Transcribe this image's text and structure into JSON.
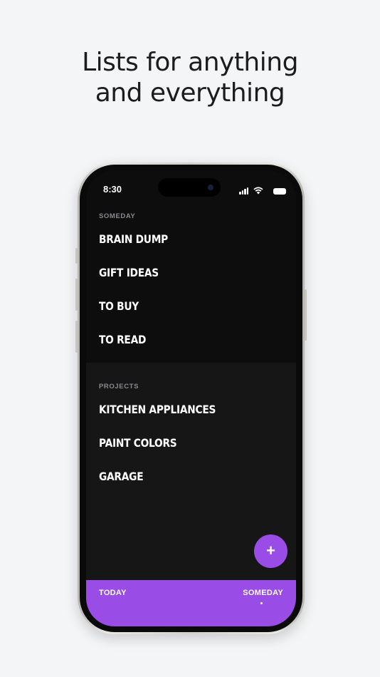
{
  "headline": {
    "line1": "Lists for anything",
    "line2": "and everything"
  },
  "status_bar": {
    "time": "8:30"
  },
  "sections": [
    {
      "title": "SOMEDAY",
      "items": [
        "BRAIN DUMP",
        "GIFT IDEAS",
        "TO BUY",
        "TO READ"
      ]
    },
    {
      "title": "PROJECTS",
      "items": [
        "KITCHEN APPLIANCES",
        "PAINT COLORS",
        "GARAGE"
      ]
    }
  ],
  "fab": {
    "label": "+"
  },
  "tabbar": {
    "today": "TODAY",
    "someday": "SOMEDAY",
    "active": "SOMEDAY"
  },
  "colors": {
    "accent": "#9a4de6",
    "background": "#f4f5f7",
    "screen_dark": "#0d0d0e"
  },
  "icons": [
    "cellular-signal-icon",
    "wifi-icon",
    "battery-icon",
    "plus-icon"
  ]
}
